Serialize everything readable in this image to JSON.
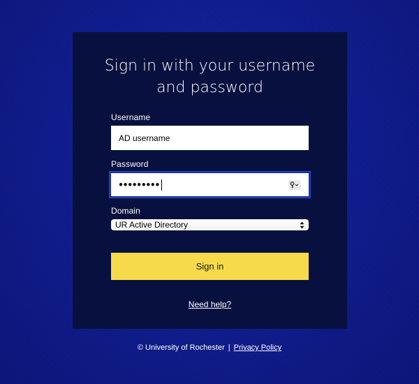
{
  "form": {
    "title_line1": "Sign in with your username",
    "title_line2": "and password",
    "username_label": "Username",
    "username_value": "AD username",
    "password_label": "Password",
    "password_mask": "●●●●●●●●●",
    "password_icon": "key-icon",
    "domain_label": "Domain",
    "domain_selected": "UR Active Directory",
    "signin_label": "Sign in",
    "help_link": "Need help?"
  },
  "footer": {
    "copyright": "© University of Rochester",
    "separator": "|",
    "privacy_link": "Privacy Policy"
  },
  "colors": {
    "background": "#0f1c8f",
    "panel": "#08103f",
    "button": "#f6da4a",
    "focus_border": "#1b2fa8"
  }
}
